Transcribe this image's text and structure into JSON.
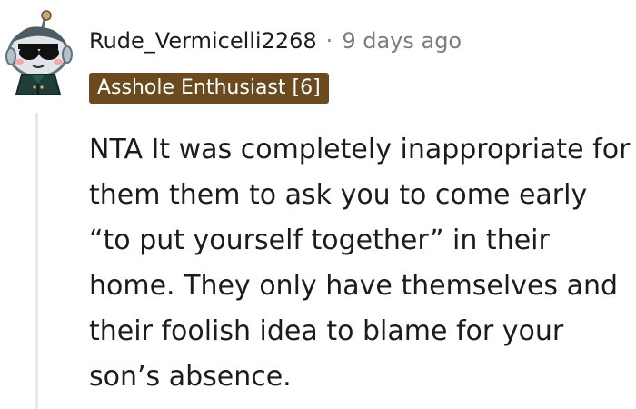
{
  "comment": {
    "author": "Rude_Vermicelli2268",
    "separator": "·",
    "timestamp": "9 days ago",
    "flair": "Asshole Enthusiast [6]",
    "body": "NTA It was completely inappropriate for them them to ask you to come early “to put yourself together” in their home. They only have themselves and their foolish idea to blame for your son’s absence."
  },
  "colors": {
    "flair_bg": "#6a4a1e",
    "meta_gray": "#7c7c7c",
    "thread_line": "#e9e9e9",
    "text": "#1c1c1c"
  },
  "icons": {
    "avatar": "snoo-avatar-icon"
  }
}
